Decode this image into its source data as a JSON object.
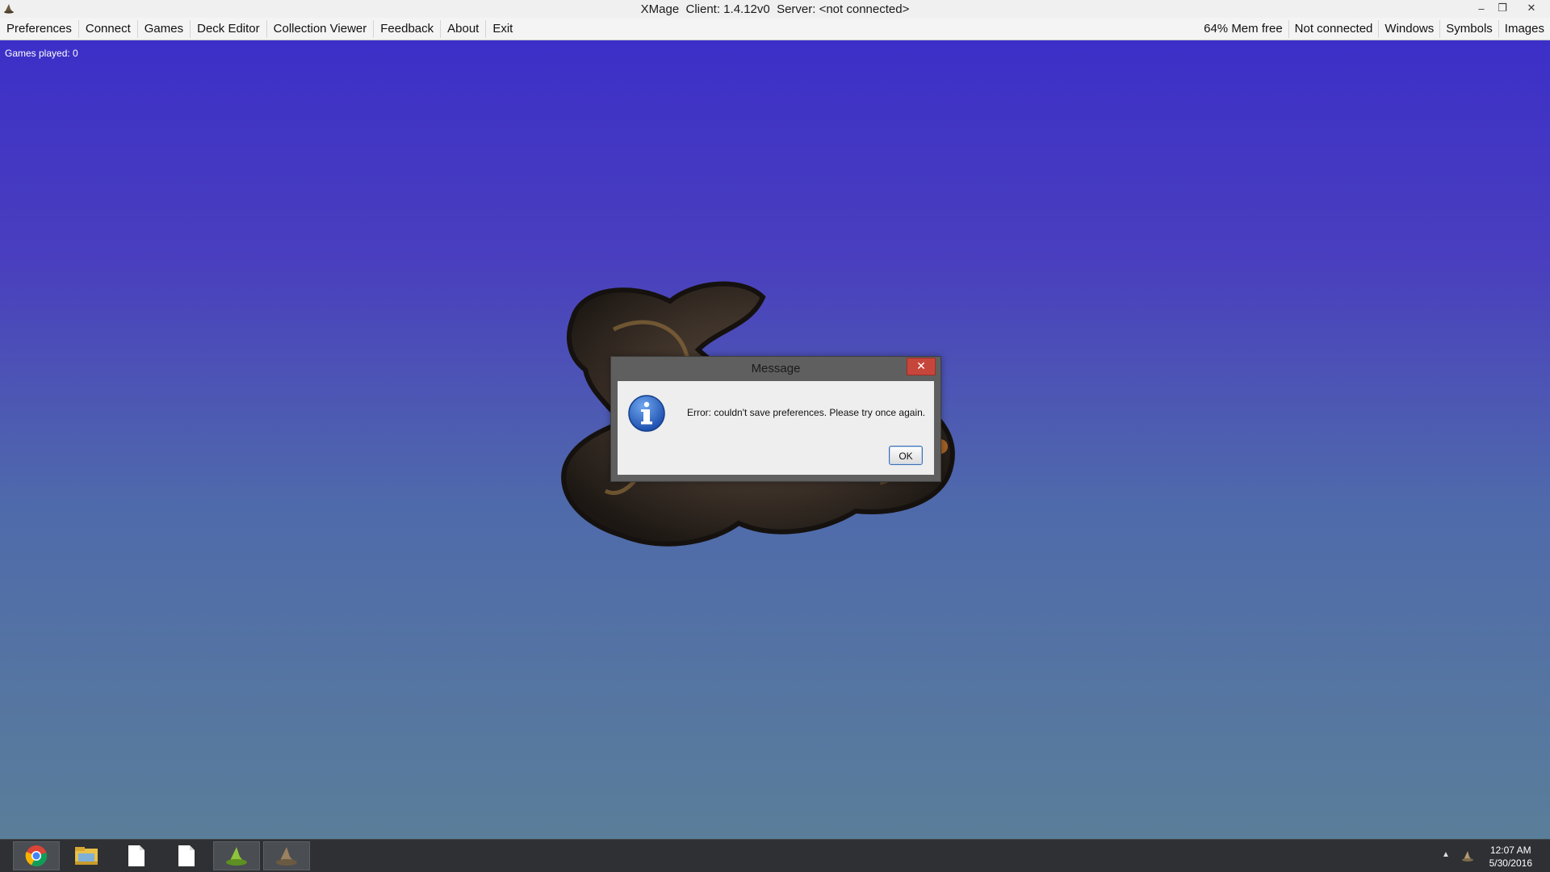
{
  "window": {
    "title": "XMage  Client: 1.4.12v0  Server: <not connected>",
    "app_icon": "xmage-hat-icon",
    "controls": {
      "minimize": "–",
      "restore": "❐",
      "close": "✕"
    }
  },
  "menubar": {
    "left": [
      {
        "label": "Preferences"
      },
      {
        "label": "Connect"
      },
      {
        "label": "Games"
      },
      {
        "label": "Deck Editor"
      },
      {
        "label": "Collection Viewer"
      },
      {
        "label": "Feedback"
      },
      {
        "label": "About"
      },
      {
        "label": "Exit"
      }
    ],
    "right": [
      {
        "label": "64% Mem free"
      },
      {
        "label": "Not connected"
      },
      {
        "label": "Windows"
      },
      {
        "label": "Symbols"
      },
      {
        "label": "Images"
      }
    ]
  },
  "desktop": {
    "games_played": "Games played: 0",
    "colors": {
      "top": "#3c2fc8",
      "bottom": "#5a7e9a"
    }
  },
  "dialog": {
    "title": "Message",
    "close_glyph": "✕",
    "icon": "information-icon",
    "message": "Error: couldn't save preferences. Please try once again.",
    "ok_label": "OK"
  },
  "taskbar": {
    "apps": [
      {
        "name": "chrome-icon",
        "active": true
      },
      {
        "name": "file-explorer-icon",
        "active": false
      },
      {
        "name": "document-icon",
        "active": false
      },
      {
        "name": "document-icon",
        "active": false
      },
      {
        "name": "xmage-launcher-icon",
        "active": true
      },
      {
        "name": "xmage-client-icon",
        "active": true
      }
    ],
    "tray": {
      "chevron": "▲",
      "time": "12:07 AM",
      "date": "5/30/2016"
    }
  }
}
